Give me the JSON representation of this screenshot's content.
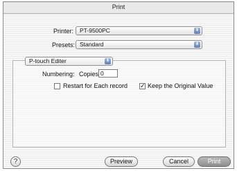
{
  "window": {
    "title": "Print"
  },
  "printer": {
    "label": "Printer:",
    "value": "PT-9500PC"
  },
  "presets": {
    "label": "Presets:",
    "value": "Standard"
  },
  "panel_select": {
    "value": "P-touch Editer"
  },
  "numbering": {
    "label": "Numbering:",
    "copies_label": "Copies",
    "copies_value": "0"
  },
  "options": {
    "restart": {
      "label": "Restart for Each record",
      "checked": false
    },
    "keep": {
      "label": "Keep the Original Value",
      "checked": true,
      "check_glyph": "✓"
    }
  },
  "footer": {
    "help": "?",
    "preview": "Preview",
    "cancel": "Cancel",
    "print": "Print"
  },
  "icons": {
    "popup_arrow": "⬍"
  }
}
